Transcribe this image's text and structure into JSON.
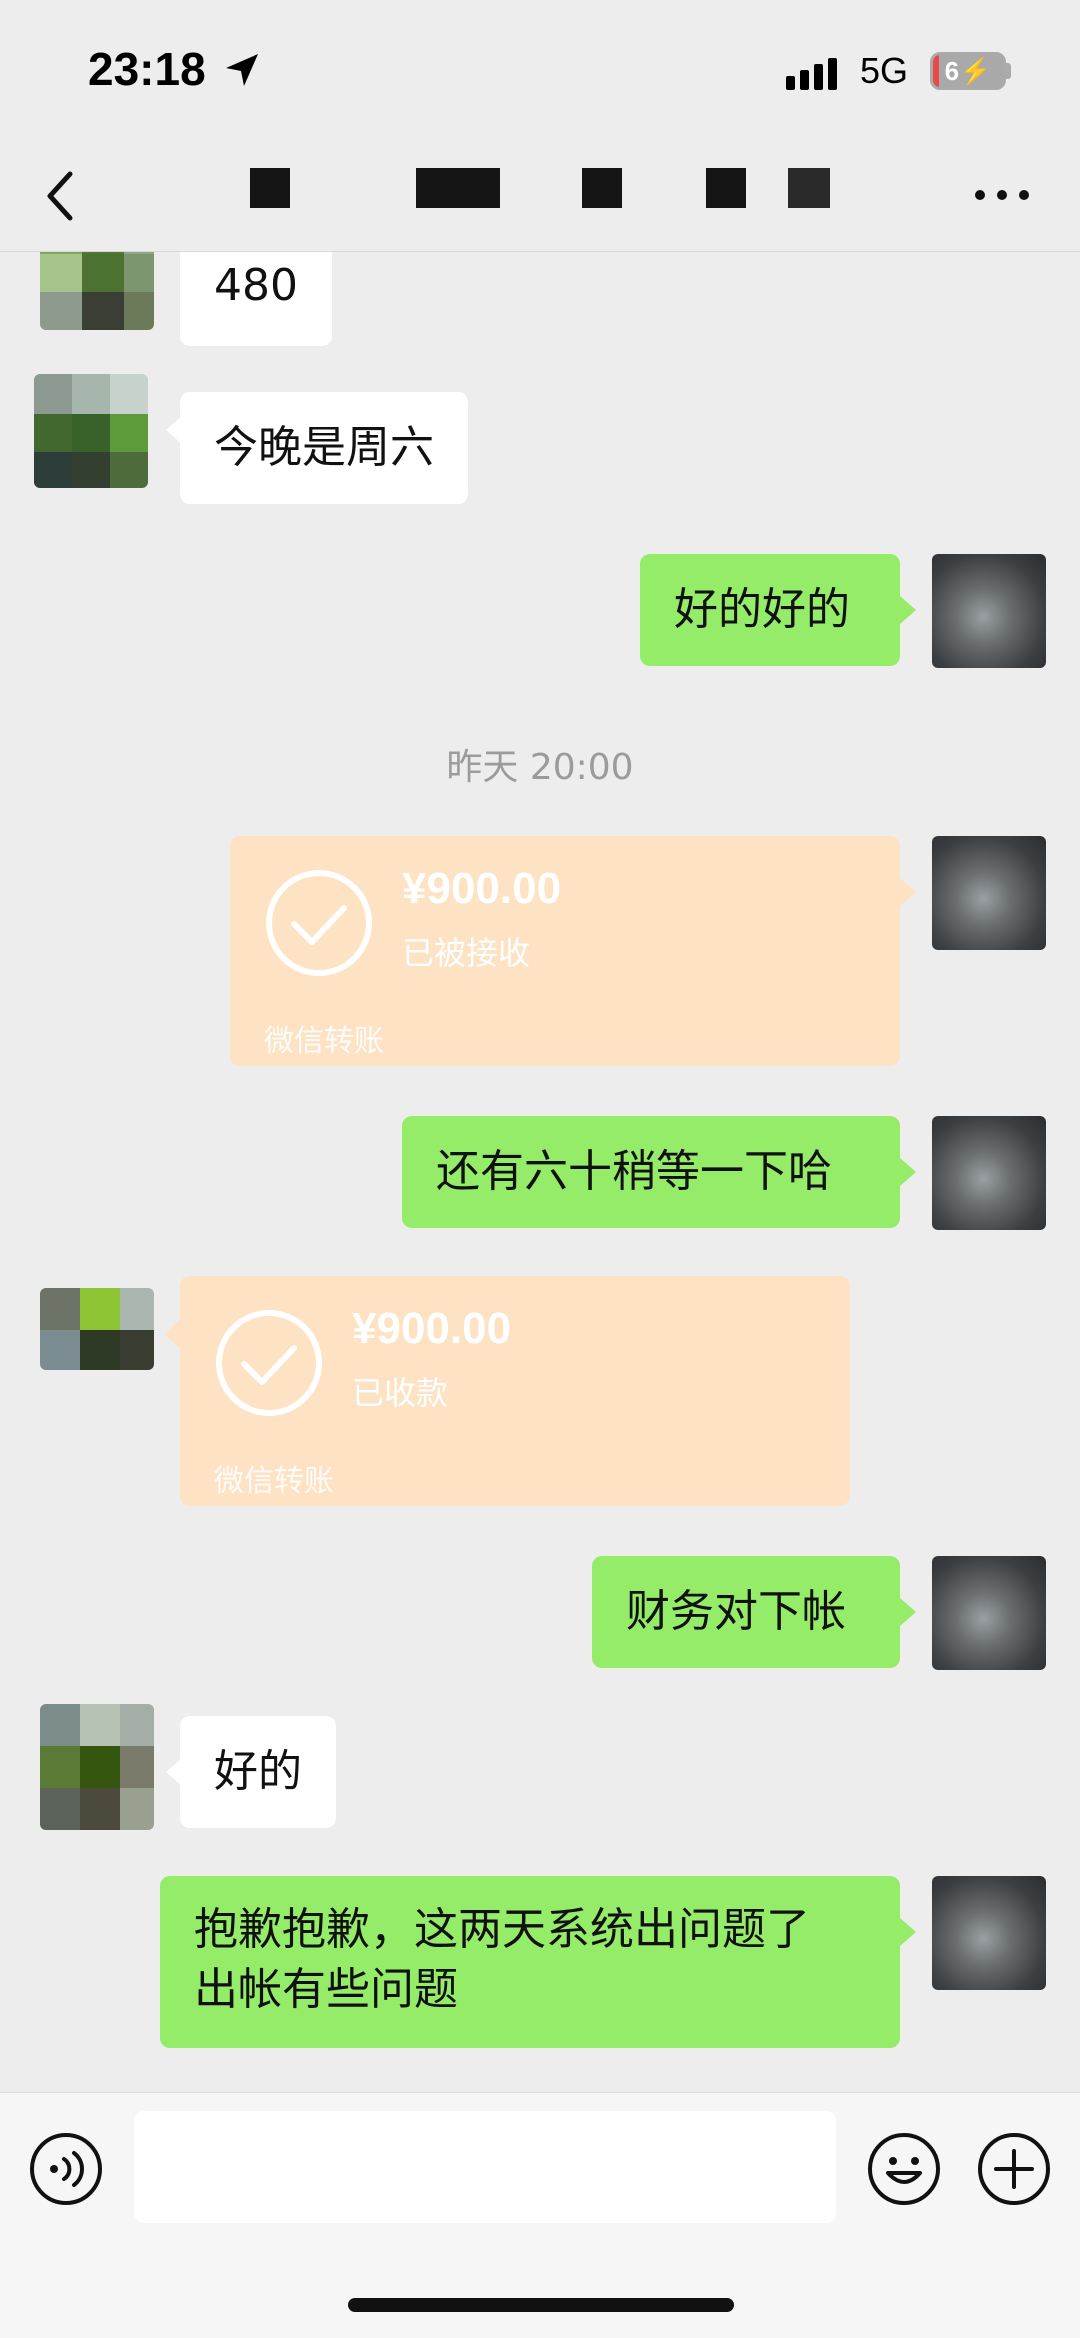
{
  "status_bar": {
    "time": "23:18",
    "network": "5G",
    "battery": "6",
    "battery_level": 0.06
  },
  "nav": {
    "back_icon": "chevron-left-icon",
    "more_icon": "more-dots-icon"
  },
  "messages": [
    {
      "side": "left",
      "type": "text",
      "text": "480"
    },
    {
      "side": "left",
      "type": "text",
      "text": "今晚是周六"
    },
    {
      "side": "right",
      "type": "text",
      "text": "好的好的"
    },
    {
      "type": "timestamp",
      "text": "昨天 20:00"
    },
    {
      "side": "right",
      "type": "transfer",
      "amount": "¥900.00",
      "status": "已被接收",
      "brand": "微信转账"
    },
    {
      "side": "right",
      "type": "text",
      "text": "还有六十稍等一下哈"
    },
    {
      "side": "left",
      "type": "transfer",
      "amount": "¥900.00",
      "status": "已收款",
      "brand": "微信转账"
    },
    {
      "side": "right",
      "type": "text",
      "text": "财务对下帐"
    },
    {
      "side": "left",
      "type": "text",
      "text": "好的"
    },
    {
      "side": "right",
      "type": "text",
      "lines": [
        "抱歉抱歉，这两天系统出问题了",
        "出帐有些问题"
      ]
    }
  ],
  "input_bar": {
    "value": "",
    "voice_icon": "voice-icon",
    "emoji_icon": "emoji-icon",
    "plus_icon": "plus-icon"
  },
  "colors": {
    "background": "#ededed",
    "my_bubble": "#95ec69",
    "their_bubble": "#ffffff",
    "transfer_card": "#fde2c3",
    "timestamp": "#9b9b9b"
  }
}
